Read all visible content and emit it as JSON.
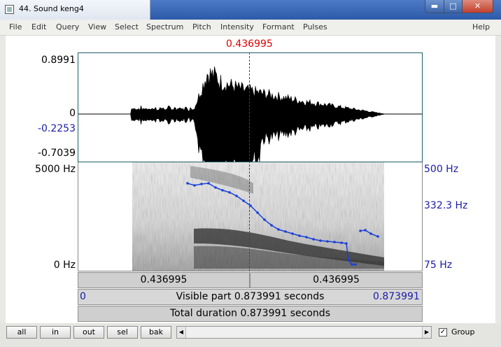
{
  "window": {
    "title": "44. Sound keng4",
    "min_glyph": "▬",
    "max_glyph": "□",
    "close_glyph": "✕"
  },
  "menu": [
    "File",
    "Edit",
    "Query",
    "View",
    "Select",
    "Spectrum",
    "Pitch",
    "Intensity",
    "Formant",
    "Pulses"
  ],
  "menu_help": "Help",
  "cursor": {
    "time_label": "0.436995"
  },
  "waveform": {
    "y_max": "0.8991",
    "y_zero": "0",
    "y_cursor": "-0.2253",
    "y_min": "-0.7039"
  },
  "spectrogram": {
    "freq_top": "5000 Hz",
    "freq_bottom": "0 Hz"
  },
  "pitch": {
    "top": "500 Hz",
    "mid": "332.3 Hz",
    "bottom": "75 Hz"
  },
  "time_bars": {
    "left_part": "0.436995",
    "right_part": "0.436995",
    "visible_start": "0",
    "visible_label": "Visible part 0.873991 seconds",
    "visible_end": "0.873991",
    "total_label": "Total duration 0.873991 seconds"
  },
  "buttons": {
    "all": "all",
    "in": "in",
    "out": "out",
    "sel": "sel",
    "bak": "bak"
  },
  "scroll": {
    "left_glyph": "◀",
    "right_glyph": "▶"
  },
  "group": {
    "label": "Group",
    "checked_glyph": "✓"
  },
  "colors": {
    "pitch_curve": "#1a3fd8",
    "cursor": "#dd0000",
    "waveform": "#000000"
  }
}
